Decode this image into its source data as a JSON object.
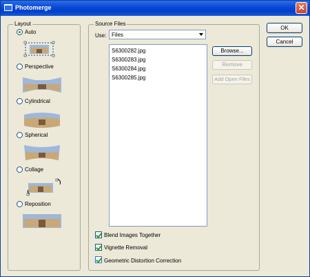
{
  "window": {
    "title": "Photomerge",
    "close_glyph": "✕"
  },
  "layout": {
    "legend": "Layout",
    "options": [
      {
        "label": "Auto",
        "selected": true
      },
      {
        "label": "Perspective",
        "selected": false
      },
      {
        "label": "Cylindrical",
        "selected": false
      },
      {
        "label": "Spherical",
        "selected": false
      },
      {
        "label": "Collage",
        "selected": false
      },
      {
        "label": "Reposition",
        "selected": false
      }
    ]
  },
  "source": {
    "legend": "Source Files",
    "use_label": "Use:",
    "use_value": "Files",
    "files": [
      "S6300282.jpg",
      "S6300283.jpg",
      "S6300284.jpg",
      "S6300285.jpg"
    ],
    "buttons": {
      "browse": "Browse...",
      "remove": "Remove",
      "add_open": "Add Open Files"
    },
    "checks": [
      {
        "label": "Blend Images Together",
        "checked": true
      },
      {
        "label": "Vignette Removal",
        "checked": true
      },
      {
        "label": "Geometric Distortion Correction",
        "checked": true
      }
    ]
  },
  "actions": {
    "ok": "OK",
    "cancel": "Cancel"
  }
}
